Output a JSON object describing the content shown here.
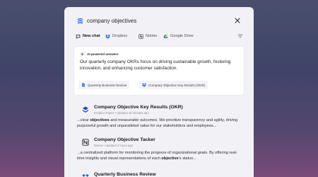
{
  "search": {
    "query": "company objectives"
  },
  "tabs": [
    {
      "label": "New chat",
      "active": true
    },
    {
      "label": "Dropbox"
    },
    {
      "label": "Notion"
    },
    {
      "label": "Google Drive"
    }
  ],
  "ai_answer": {
    "label": "AI-powered answers",
    "text": "Our quarterly company OKRs focus on driving sustainable growth, fostering innovation, and enhancing customer satisfaction.",
    "sources": [
      "Quarterly Business Review",
      "Company Objective Key Results (OKR)"
    ]
  },
  "results": [
    {
      "title": "Company Objective Key Results (OKR)",
      "meta": "Dropbox Paper • Updated 15 minutes ago",
      "snippet_pre": "...clear ",
      "snippet_bold": "objectives",
      "snippet_post": " and measurable outcomes. We prioritize transparency and agility, driving purposeful growth and unparalleled value for our stakeholders and employees...",
      "icon": "dropbox-paper-icon"
    },
    {
      "title": "Company Objective Tacker",
      "meta": "Notion • Updated 2 hours ago",
      "snippet_pre": "...a centralized platform for monitoring the progress of organizational goals. By offering real-time insights and visual representations of each ",
      "snippet_bold": "objective",
      "snippet_post": "'s status...",
      "icon": "notion-icon"
    },
    {
      "title": "Quarterly Business Review",
      "icon": "dropbox-icon"
    }
  ],
  "colors": {
    "accent": "#1f5cf0",
    "dropbox": "#1f5cf0",
    "background": "#f2f2f6"
  }
}
